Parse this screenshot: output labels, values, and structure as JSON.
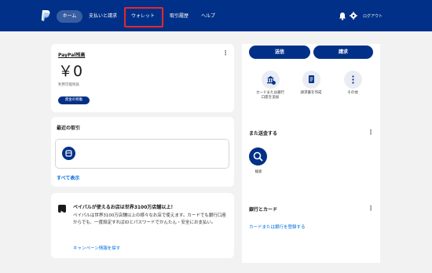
{
  "nav": {
    "items": [
      "ホーム",
      "支払いと請求",
      "ウォレット",
      "取引履歴",
      "ヘルプ"
    ],
    "logout": "ログアウト"
  },
  "balance": {
    "title": "PayPal残高",
    "amount": "￥0",
    "subtitle": "利用可能残高",
    "move_button": "資金の移動"
  },
  "recent": {
    "title": "最近の取引",
    "see_all": "すべて表示"
  },
  "promo": {
    "title": "ペイパルが使えるお店は世界3100万店舗以上！",
    "body": "ペイパルは世界3100万店舗以上の様々なお店で使えます。カードでも銀行口座からでも、一度設定すればIDとパスワードでかんたん・安全にお支払い。",
    "link": "キャンペーン情報を探す"
  },
  "actions": {
    "send": "送信",
    "request": "請求",
    "quick": [
      {
        "label": "カードまたは銀行口座を追加",
        "icon": "bank-icon"
      },
      {
        "label": "請求書を作成",
        "icon": "invoice-icon"
      },
      {
        "label": "その他",
        "icon": "more-icon"
      }
    ]
  },
  "send_again": {
    "title": "また送金する",
    "search_label": "検索"
  },
  "banks": {
    "title": "銀行とカード",
    "link": "カードまたは銀行を登録する"
  },
  "colors": {
    "brand_navy": "#003087",
    "link_blue": "#0070e0",
    "highlight_red": "#e5282f"
  }
}
